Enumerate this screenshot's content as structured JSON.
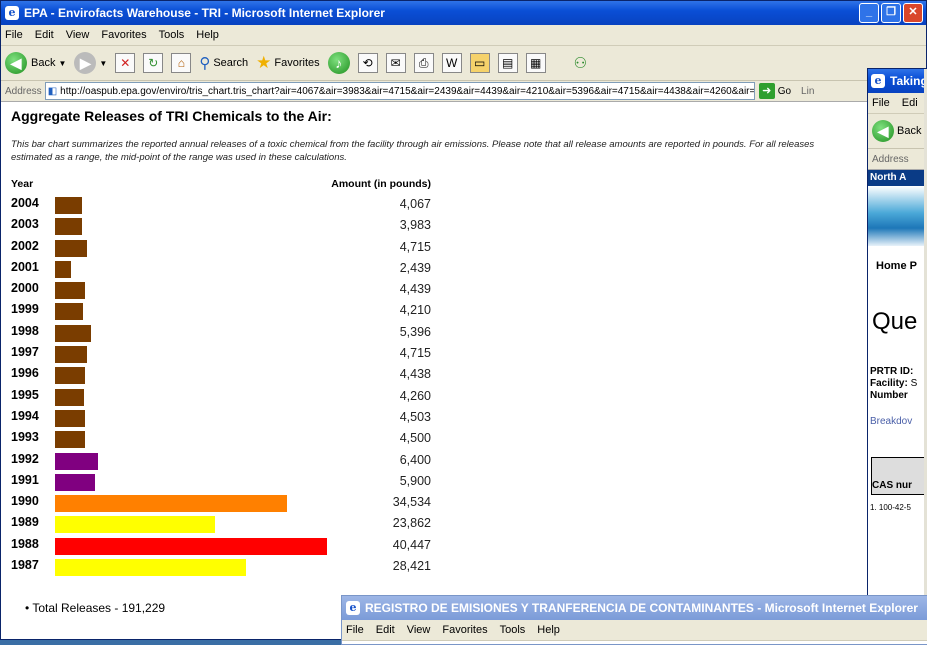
{
  "main_window": {
    "title": "EPA - Envirofacts Warehouse - TRI - Microsoft Internet Explorer",
    "menu": [
      "File",
      "Edit",
      "View",
      "Favorites",
      "Tools",
      "Help"
    ],
    "toolbar": {
      "back": "Back",
      "search": "Search",
      "favorites": "Favorites"
    },
    "address_label": "Address",
    "address_url": "http://oaspub.epa.gov/enviro/tris_chart.tris_chart?air=4067&air=3983&air=4715&air=2439&air=4439&air=4210&air=5396&air=4715&air=4438&air=4260&air=",
    "go_label": "Go",
    "links_label": "Lin",
    "page": {
      "heading": "Aggregate Releases of TRI Chemicals to the Air:",
      "description": "This bar chart summarizes the reported annual releases of a toxic chemical from the facility through air emissions. Please note that all release amounts are reported in pounds. For all releases estimated as a range, the mid-point of the range was used in these calculations.",
      "year_header": "Year",
      "amount_header": "Amount (in pounds)",
      "total": "Total Releases - 191,229"
    }
  },
  "chart_data": {
    "type": "bar",
    "categories": [
      "2004",
      "2003",
      "2002",
      "2001",
      "2000",
      "1999",
      "1998",
      "1997",
      "1996",
      "1995",
      "1994",
      "1993",
      "1992",
      "1991",
      "1990",
      "1989",
      "1988",
      "1987"
    ],
    "values": [
      4067,
      3983,
      4715,
      2439,
      4439,
      4210,
      5396,
      4715,
      4438,
      4260,
      4503,
      4500,
      6400,
      5900,
      34534,
      23862,
      40447,
      28421
    ],
    "labels": [
      "4,067",
      "3,983",
      "4,715",
      "2,439",
      "4,439",
      "4,210",
      "5,396",
      "4,715",
      "4,438",
      "4,260",
      "4,503",
      "4,500",
      "6,400",
      "5,900",
      "34,534",
      "23,862",
      "40,447",
      "28,421"
    ],
    "colors": [
      "#7a3d00",
      "#7a3d00",
      "#7a3d00",
      "#7a3d00",
      "#7a3d00",
      "#7a3d00",
      "#7a3d00",
      "#7a3d00",
      "#7a3d00",
      "#7a3d00",
      "#7a3d00",
      "#7a3d00",
      "#800080",
      "#800080",
      "#ff8000",
      "#ffff00",
      "#ff0000",
      "#ffff00"
    ],
    "xlabel": "Amount (in pounds)",
    "ylabel": "Year"
  },
  "right_window": {
    "title": "Taking",
    "menu": [
      "File",
      "Edi"
    ],
    "back": "Back",
    "address_label": "Address",
    "banner": "North A",
    "nav": "Home P",
    "heading": "Que",
    "prtr_label": "PRTR ID:",
    "facility_label": "Facility:",
    "facility_val": "S",
    "number_label": "Number",
    "breakdown": "Breakdov",
    "cas": "CAS nur",
    "first_row": "1. 100-42-5"
  },
  "bottom_window": {
    "title": "REGISTRO DE EMISIONES Y TRANFERENCIA DE CONTAMINANTES - Microsoft Internet Explorer",
    "menu": [
      "File",
      "Edit",
      "View",
      "Favorites",
      "Tools",
      "Help"
    ]
  }
}
